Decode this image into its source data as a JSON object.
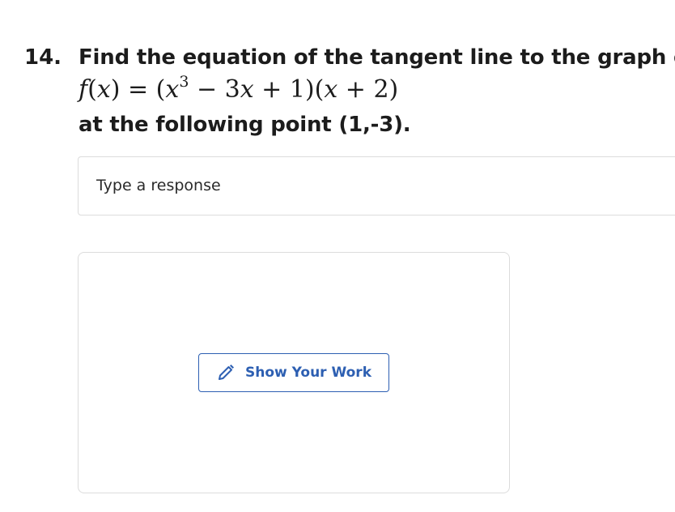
{
  "question": {
    "number": "14.",
    "line1": "Find the equation of the tangent line to the graph of",
    "formula": {
      "func": "f",
      "var": "x",
      "open_paren": "(",
      "close_paren": ")",
      "equals": " = (",
      "x3": "x",
      "exp": "3",
      "rest1": " − 3",
      "x2": "x",
      "rest2": " + 1)(",
      "x4": "x",
      "rest3": " + 2)"
    },
    "line3": "at the following point (1,-3)."
  },
  "response": {
    "placeholder": "Type a response",
    "value": ""
  },
  "work_panel": {
    "button_label": "Show Your Work",
    "button_icon": "pencil-icon"
  },
  "colors": {
    "accent": "#2d5fb2",
    "border": "#dcdcdc",
    "text": "#1c1c1c"
  }
}
